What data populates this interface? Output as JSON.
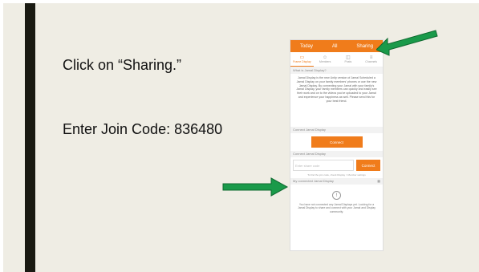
{
  "slide": {
    "instruction_1": "Click on “Sharing.”",
    "instruction_2": "Enter Join Code: 836480"
  },
  "app": {
    "top_tabs": [
      "Today",
      "All",
      "Sharing"
    ],
    "icon_tabs": [
      {
        "label": "Frame Display",
        "icon": "frame-icon"
      },
      {
        "label": "Members",
        "icon": "members-icon"
      },
      {
        "label": "Posts",
        "icon": "posts-icon"
      },
      {
        "label": "Channels",
        "icon": "channels-icon"
      }
    ],
    "section_what": "What is Jamal Display?",
    "what_text": "Jamal Display is the new Unity version of Jamal Scheduled a Jamal Display on your family members' phones or use the new Jamal Display. By connecting your Jamal with your family's Jamal Display, your family members can quickly and easily see their work and on to the videos you've uploaded to your Jamal and experience your happiness as well. Please send this for your best friend.",
    "section_connect": "Connect Jamal Display",
    "connect_button": "Connect",
    "section_join": "Connect Jamal Display",
    "join_placeholder": "Enter share code",
    "join_button": "Connect",
    "join_hint": "To find the join code, check Display > Member settings",
    "section_connected": "My connected Jamal Display",
    "empty_text": "You have not connected any Jamal Displays yet. Looking for a Jamal Display to share and connect with your Jamal and Display community.",
    "accent_color": "#f07c1b"
  },
  "arrow_color": "#1a9a4a"
}
